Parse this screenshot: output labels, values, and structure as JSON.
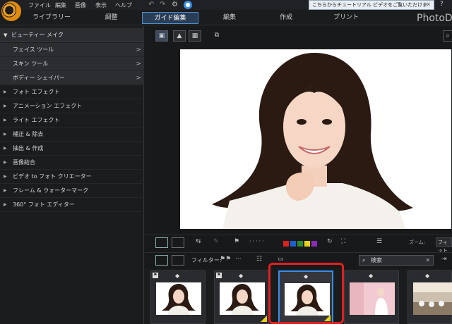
{
  "menubar": {
    "items": [
      "ファイル",
      "編集",
      "画像",
      "表示",
      "ヘルプ"
    ]
  },
  "tutorial_banner": {
    "text": "こちらからチュートリアル ビデオをご覧いただけます。",
    "close": "✕"
  },
  "help": "?",
  "mode_tabs": [
    "ライブラリー",
    "調整",
    "ガイド編集",
    "編集",
    "作成",
    "プリント"
  ],
  "active_mode": "ガイド編集",
  "app_name": "PhotoD",
  "sidebar": {
    "header": "ビューティー メイク",
    "subitems": [
      "フェイス ツール",
      "スキン ツール",
      "ボディー シェイパー"
    ],
    "items": [
      "フォト エフェクト",
      "アニメーション エフェクト",
      "ライト エフェクト",
      "補正 & 除去",
      "抽出 & 作成",
      "画像結合",
      "ビデオ to フォト クリエーター",
      "フレーム & ウォーターマーク",
      "360° フォト エディター"
    ]
  },
  "toolbar": {
    "zoom_label": "ズーム:",
    "zoom_value": "フィット",
    "colors": [
      "#e02020",
      "#1f5fd0",
      "#2c8a2c",
      "#e8d21a",
      "#8a2cb8"
    ]
  },
  "filter": {
    "label": "フィルター:",
    "search_placeholder": "検索"
  },
  "thumbnails": [
    {
      "kind": "portrait",
      "flag": true,
      "rated": false
    },
    {
      "kind": "portrait",
      "flag": true,
      "rated": true
    },
    {
      "kind": "portrait",
      "flag": false,
      "rated": true,
      "selected": true
    },
    {
      "kind": "bridal",
      "flag": false,
      "rated": false
    },
    {
      "kind": "hall",
      "flag": false,
      "rated": false
    }
  ]
}
